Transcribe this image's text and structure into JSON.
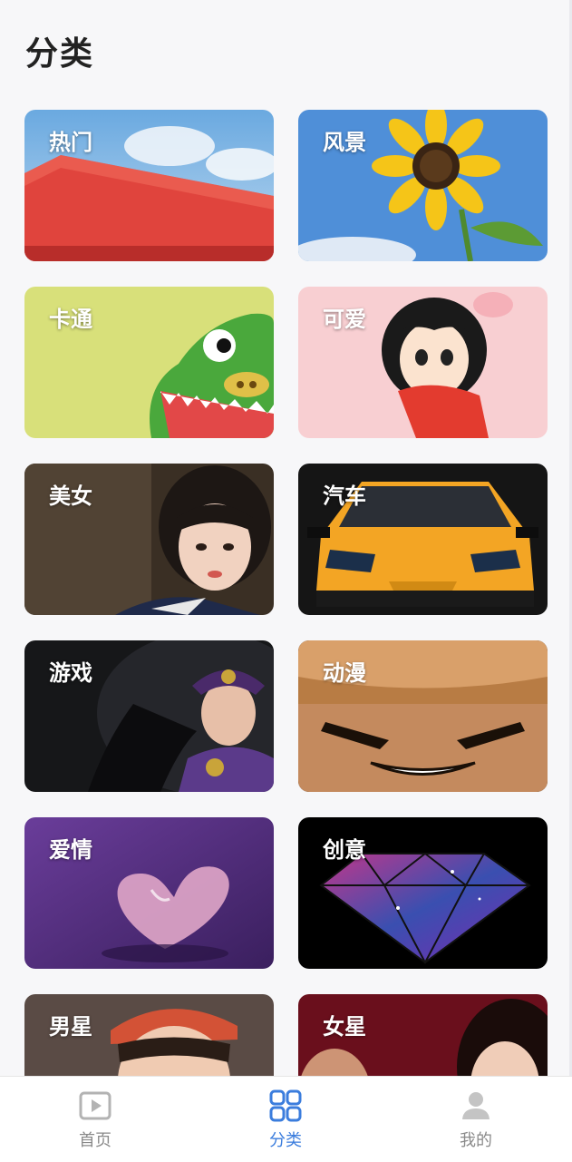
{
  "header": {
    "title": "分类"
  },
  "categories": [
    {
      "label": "热门",
      "icon": "watermelon-image"
    },
    {
      "label": "风景",
      "icon": "sunflower-image"
    },
    {
      "label": "卡通",
      "icon": "cartoon-dinosaur-image"
    },
    {
      "label": "可爱",
      "icon": "cute-girl-image"
    },
    {
      "label": "美女",
      "icon": "girl-portrait-image"
    },
    {
      "label": "汽车",
      "icon": "sports-car-image"
    },
    {
      "label": "游戏",
      "icon": "game-character-image"
    },
    {
      "label": "动漫",
      "icon": "anime-image"
    },
    {
      "label": "爱情",
      "icon": "heart-ice-image"
    },
    {
      "label": "创意",
      "icon": "diamond-image"
    },
    {
      "label": "男星",
      "icon": "male-star-image"
    },
    {
      "label": "女星",
      "icon": "female-star-image"
    }
  ],
  "tabbar": {
    "items": [
      {
        "label": "首页",
        "icon": "play-icon",
        "active": false
      },
      {
        "label": "分类",
        "icon": "grid-icon",
        "active": true
      },
      {
        "label": "我的",
        "icon": "user-icon",
        "active": false
      }
    ]
  },
  "colors": {
    "accent": "#3b7ddd",
    "inactive": "#8a8a8a",
    "background": "#f7f7f9"
  }
}
